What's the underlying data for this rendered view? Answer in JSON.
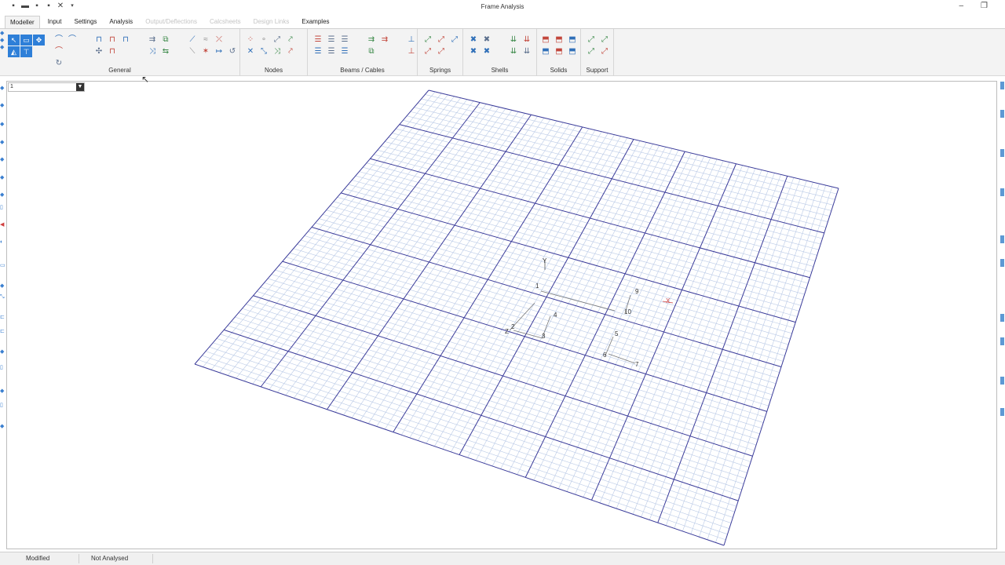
{
  "window": {
    "title": "Frame Analysis",
    "minimize_icon": "minimize-icon",
    "restore_icon": "restore-icon"
  },
  "quick_access": [
    "app-menu-icon",
    "open-icon",
    "save-icon",
    "save-all-icon",
    "close-icon",
    "customize-icon"
  ],
  "tabs": [
    {
      "label": "Modeller",
      "active": true,
      "enabled": true
    },
    {
      "label": "Input",
      "active": false,
      "enabled": true
    },
    {
      "label": "Settings",
      "active": false,
      "enabled": true
    },
    {
      "label": "Analysis",
      "active": false,
      "enabled": true
    },
    {
      "label": "Output/Deflections",
      "active": false,
      "enabled": false
    },
    {
      "label": "Calcsheets",
      "active": false,
      "enabled": false
    },
    {
      "label": "Design Links",
      "active": false,
      "enabled": false
    },
    {
      "label": "Examples",
      "active": false,
      "enabled": true
    }
  ],
  "ribbon": {
    "groups": [
      {
        "label": "General"
      },
      {
        "label": "Nodes"
      },
      {
        "label": "Beams / Cables"
      },
      {
        "label": "Springs"
      },
      {
        "label": "Shells"
      },
      {
        "label": "Solids"
      },
      {
        "label": "Support"
      }
    ]
  },
  "load_case": {
    "value": "1"
  },
  "model": {
    "node_labels": [
      "1",
      "2",
      "3",
      "4",
      "5",
      "6",
      "7",
      "9",
      "10"
    ],
    "axis_labels": [
      "Y",
      "Z",
      "X"
    ]
  },
  "status": {
    "modified": "Modified",
    "analysed": "Not Analysed"
  },
  "colors": {
    "grid_fine": "#b9c9e6",
    "grid_major": "#3b3c9a",
    "accent": "#2e7fd8"
  }
}
